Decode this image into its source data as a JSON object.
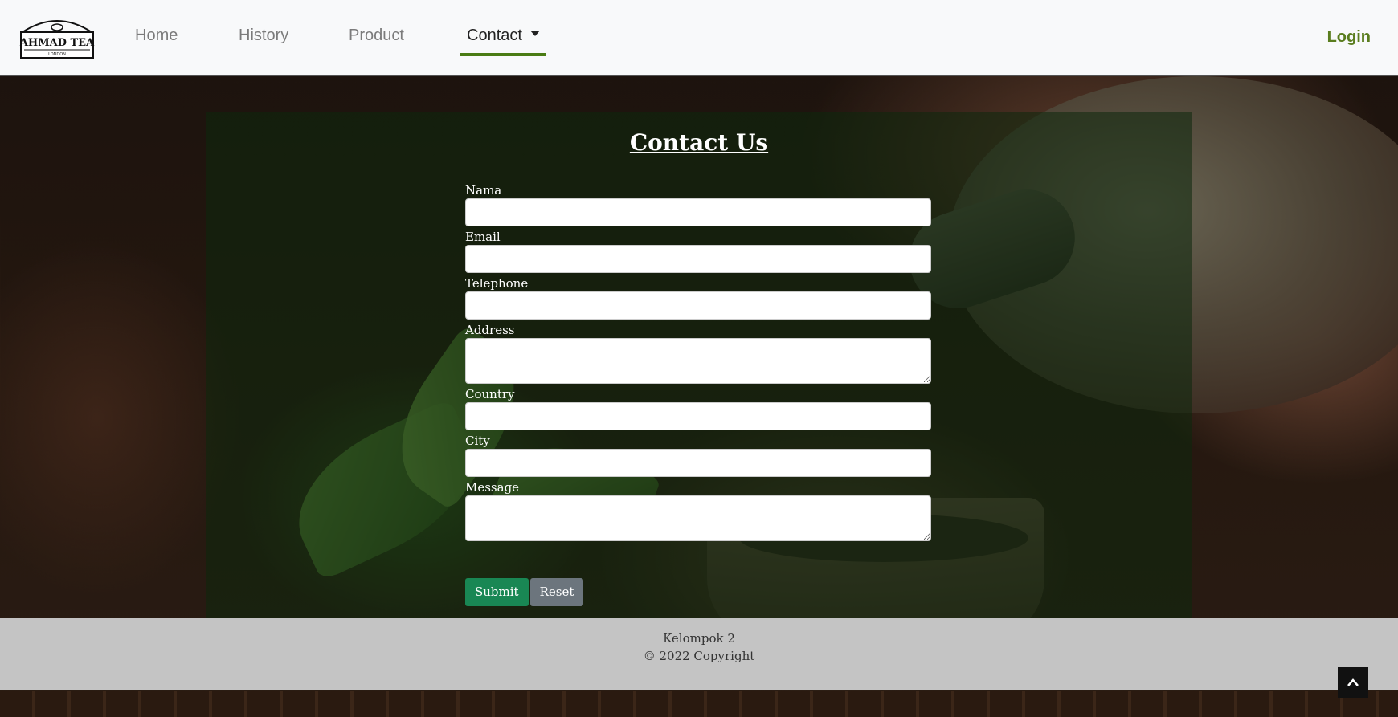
{
  "nav": {
    "logo_text": "AHMAD TEA",
    "logo_subtext": "LONDON",
    "links": [
      {
        "label": "Home"
      },
      {
        "label": "History"
      },
      {
        "label": "Product"
      },
      {
        "label": "Contact"
      }
    ],
    "active": "Contact",
    "login_label": "Login",
    "accent_color": "#4a7c14"
  },
  "contact": {
    "title": "Contact Us",
    "fields": {
      "nama": {
        "label": "Nama",
        "value": ""
      },
      "email": {
        "label": "Email",
        "value": ""
      },
      "telephone": {
        "label": "Telephone",
        "value": ""
      },
      "address": {
        "label": "Address",
        "value": ""
      },
      "country": {
        "label": "Country",
        "value": ""
      },
      "city": {
        "label": "City",
        "value": ""
      },
      "message": {
        "label": "Message",
        "value": ""
      }
    },
    "submit_label": "Submit",
    "reset_label": "Reset",
    "submit_color": "#198754",
    "reset_color": "#6c757d"
  },
  "footer": {
    "line1": "Kelompok 2",
    "line2": "© 2022 Copyright"
  },
  "icons": {
    "back_to_top": "chevron-up-icon",
    "dropdown": "caret-down-icon"
  }
}
